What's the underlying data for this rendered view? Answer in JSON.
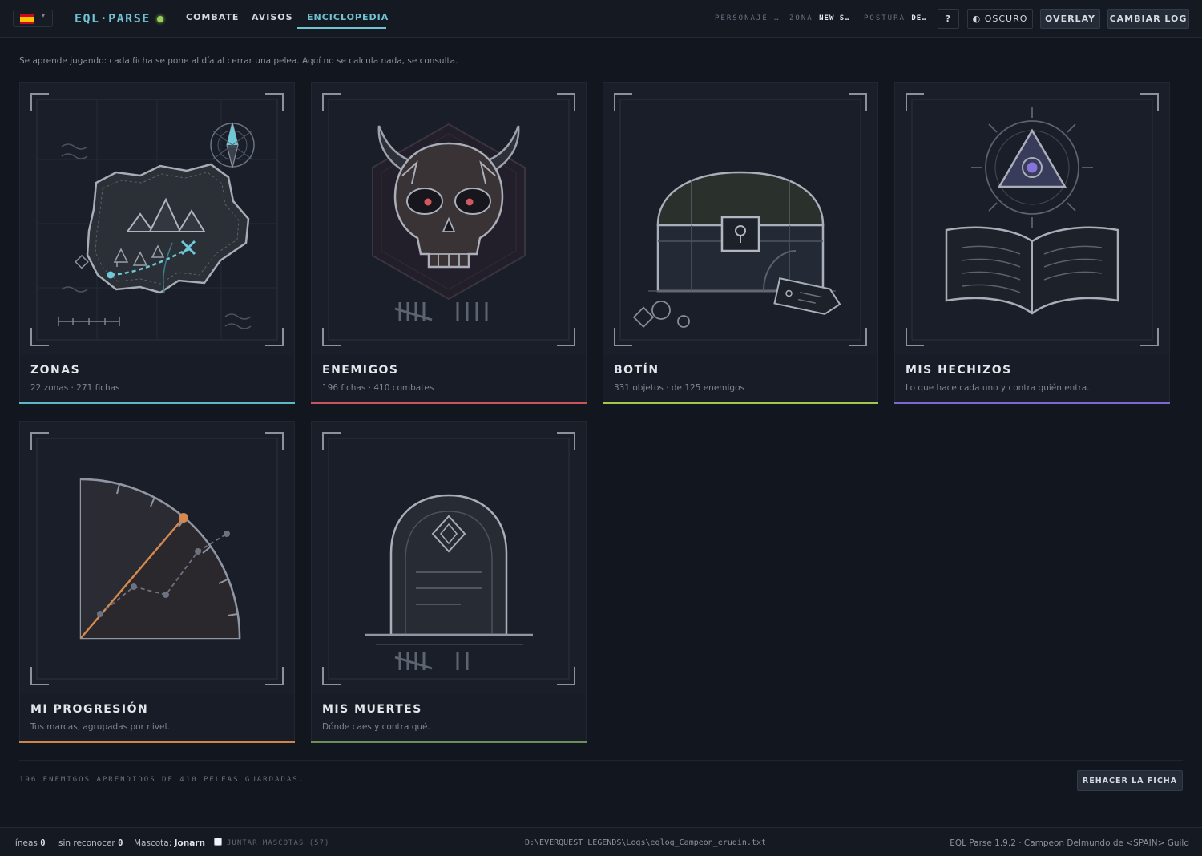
{
  "topbar": {
    "brand": "EQL·PARSE",
    "tabs": [
      {
        "label": "COMBATE"
      },
      {
        "label": "AVISOS"
      },
      {
        "label": "ENCICLOPEDIA"
      }
    ],
    "status": {
      "personaje_label": "PERSONAJE …",
      "zona_label": "ZONA",
      "zona_value": "NEW S…",
      "postura_label": "POSTURA",
      "postura_value": "DE…"
    },
    "help_label": "?",
    "theme_label": "◐ OSCURO",
    "overlay_label": "OVERLAY",
    "change_log_label": "CAMBIAR LOG"
  },
  "intro_text": "Se aprende jugando: cada ficha se pone al día al cerrar una pelea. Aquí no se calcula nada, se consulta.",
  "cards": [
    {
      "title": "ZONAS",
      "subtitle": "22 zonas · 271 fichas",
      "accent": "#5fb8c8"
    },
    {
      "title": "ENEMIGOS",
      "subtitle": "196 fichas · 410 combates",
      "accent": "#c8545c"
    },
    {
      "title": "BOTÍN",
      "subtitle": "331 objetos · de 125 enemigos",
      "accent": "#a4c64a"
    },
    {
      "title": "MIS HECHIZOS",
      "subtitle": "Lo que hace cada uno y contra quién entra.",
      "accent": "#7b68d2"
    },
    {
      "title": "MI PROGRESIÓN",
      "subtitle": "Tus marcas, agrupadas por nivel.",
      "accent": "#d2834a"
    },
    {
      "title": "MIS MUERTES",
      "subtitle": "Dónde caes y contra qué.",
      "accent": "#6e8f58"
    }
  ],
  "summary_text": "196 ENEMIGOS APRENDIDOS DE 410 PELEAS GUARDADAS.",
  "rebuild_label": "REHACER LA FICHA",
  "footer": {
    "lines_label": "líneas",
    "lines_value": "0",
    "unrecognized_label": "sin reconocer",
    "unrecognized_value": "0",
    "pet_label": "Mascota:",
    "pet_value": "Jonarn",
    "merge_pets_label": "JUNTAR MASCOTAS (57)",
    "log_path": "D:\\EVERQUEST LEGENDS\\Logs\\eqlog_Campeon_erudin.txt",
    "version": "EQL Parse 1.9.2 · Campeon Delmundo de <SPAIN> Guild"
  }
}
